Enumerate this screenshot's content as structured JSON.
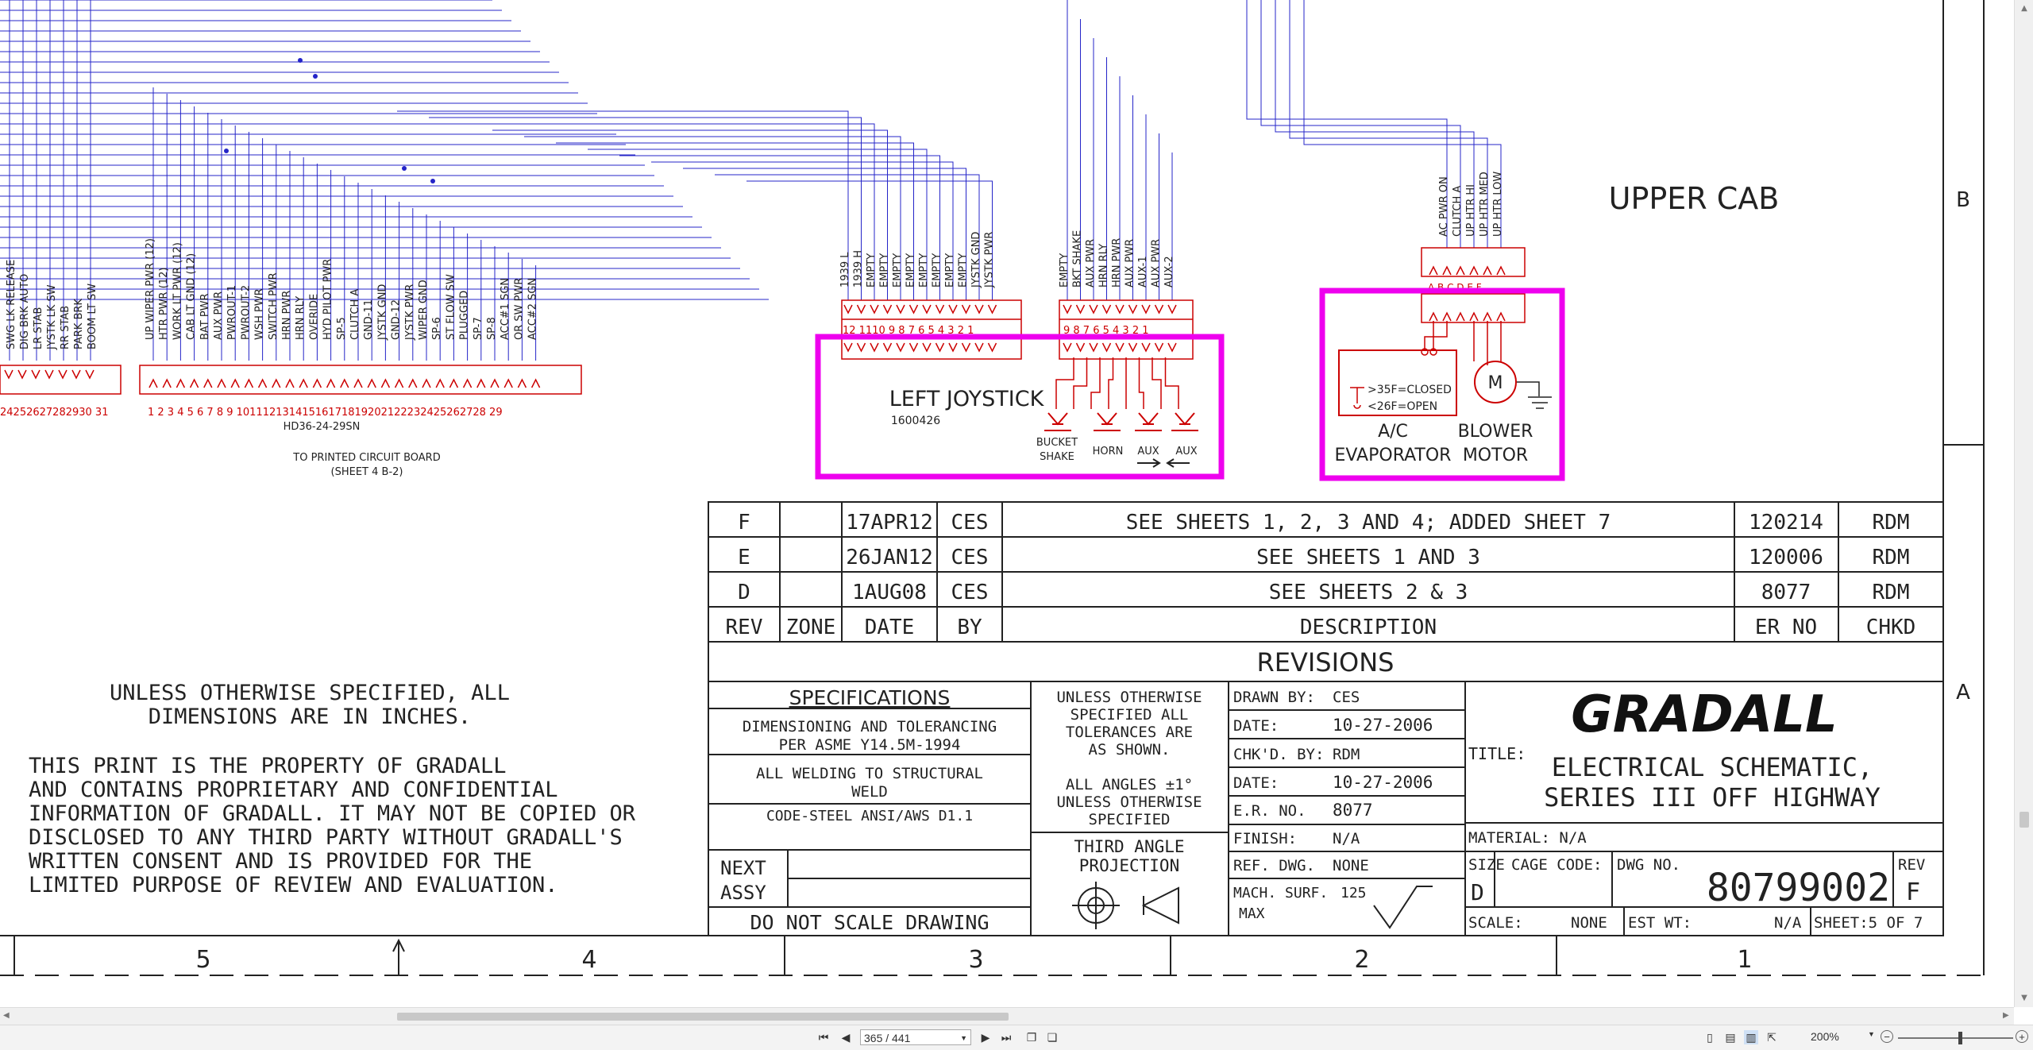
{
  "wires": {
    "left_block_labels": [
      "SWG LK RELEASE",
      "DIG BRK AUTO",
      "LR STAB",
      "JYSTK LK SW",
      "RR STAB",
      "PARK BRK",
      "BOOM LT SW"
    ],
    "left_block_pins": "24252627282930 31",
    "mid_block_labels": [
      "UP WIPER PWR (12)",
      "HTR PWR (12)",
      "WORK LT PWR (12)",
      "CAB LT GND (12)",
      "BAT PWR",
      "AUX PWR",
      "PWROUT-1",
      "PWROUT-2",
      "WSH PWR",
      "SWITCH PWR",
      "HRN PWR",
      "HRN RLY",
      "OVERIDE",
      "HYD PILOT PWR",
      "SP-5",
      "CLUTCH A",
      "GND-11",
      "JYSTK GND",
      "GND-12",
      "JYSTK PWR",
      "WIPER GND",
      "SP-6",
      "ST FLOW SW",
      "PLUGGED",
      "SP-7",
      "SP-8",
      "ACC#1 SGN",
      "OR SW PWR",
      "ACC#2 SGN"
    ],
    "mid_block_pins": "1 2 3 4 5 6 7 8 9 10111213141516171819202122232425262728 29",
    "connector_id": "HD36-24-29SN",
    "pcb_note_1": "TO PRINTED CIRCUIT BOARD",
    "pcb_note_2": "(SHEET 4 B-2)"
  },
  "left_joystick": {
    "labels": [
      "1939 L",
      "1939 H",
      "EMPTY",
      "EMPTY",
      "EMPTY",
      "EMPTY",
      "EMPTY",
      "EMPTY",
      "EMPTY",
      "EMPTY",
      "JYSTK GND",
      "JYSTK PWR"
    ],
    "pins": "12 1110 9 8 7 6 5 4 3 2 1",
    "title": "LEFT JOYSTICK",
    "part_no": "1600426"
  },
  "aux_connector": {
    "labels": [
      "EMPTY",
      "BKT SHAKE",
      "AUX PWR",
      "HRN RLY",
      "HRN PWR",
      "AUX PWR",
      "AUX-1",
      "AUX PWR",
      "AUX-2"
    ],
    "pins": "9 8 7 6 5 4 3 2 1",
    "bucket_shake_1": "BUCKET",
    "bucket_shake_2": "SHAKE",
    "horn": "HORN",
    "aux_a": "AUX",
    "aux_b": "AUX"
  },
  "upper_cab": {
    "title": "UPPER CAB",
    "hvac_labels": [
      "AC PWR ON",
      "CLUTCH A",
      "UP HTR HI",
      "UP HTR MED",
      "UP HTR LOW"
    ],
    "hvac_pins": "A B C D E F",
    "thermo_1": ">35F=CLOSED",
    "thermo_2": "<26F=OPEN",
    "motor_symbol": "M",
    "ac_1": "A/C",
    "ac_2": "EVAPORATOR",
    "blower_1": "BLOWER",
    "blower_2": "MOTOR"
  },
  "zones": {
    "b": "B",
    "a": "A",
    "cols": [
      "5",
      "4",
      "3",
      "2",
      "1"
    ]
  },
  "revisions": {
    "rows": [
      {
        "rev": "F",
        "zone": "",
        "date": "17APR12",
        "by": "CES",
        "desc": "SEE SHEETS 1, 2, 3 AND 4; ADDED SHEET 7",
        "er": "120214",
        "chkd": "RDM"
      },
      {
        "rev": "E",
        "zone": "",
        "date": "26JAN12",
        "by": "CES",
        "desc": "SEE SHEETS 1 AND 3",
        "er": "120006",
        "chkd": "RDM"
      },
      {
        "rev": "D",
        "zone": "",
        "date": "1AUG08",
        "by": "CES",
        "desc": "SEE SHEETS 2 & 3",
        "er": "8077",
        "chkd": "RDM"
      }
    ],
    "headers": {
      "rev": "REV",
      "zone": "ZONE",
      "date": "DATE",
      "by": "BY",
      "desc": "DESCRIPTION",
      "er": "ER NO",
      "chkd": "CHKD"
    },
    "title": "REVISIONS"
  },
  "notes": {
    "dims_1": "UNLESS OTHERWISE SPECIFIED, ALL",
    "dims_2": "DIMENSIONS ARE IN INCHES.",
    "prop": [
      "THIS PRINT IS THE PROPERTY OF GRADALL",
      "AND CONTAINS PROPRIETARY AND CONFIDENTIAL",
      "INFORMATION OF GRADALL. IT MAY NOT BE COPIED OR",
      "DISCLOSED TO ANY THIRD PARTY WITHOUT GRADALL'S",
      "WRITTEN CONSENT AND IS PROVIDED FOR THE",
      "LIMITED PURPOSE OF REVIEW AND EVALUATION."
    ]
  },
  "specs": {
    "title": "SPECIFICATIONS",
    "s1a": "DIMENSIONING AND TOLERANCING",
    "s1b": "PER ASME Y14.5M-1994",
    "s2a": "ALL WELDING TO STRUCTURAL",
    "s2b": "WELD",
    "s3": "CODE-STEEL ANSI/AWS D1.1",
    "next": "NEXT",
    "assy": "ASSY",
    "dns": "DO NOT SCALE DRAWING",
    "tol": [
      "UNLESS OTHERWISE",
      "SPECIFIED ALL",
      "TOLERANCES ARE",
      "AS SHOWN."
    ],
    "ang": [
      "ALL ANGLES ±1°",
      "UNLESS OTHERWISE",
      "SPECIFIED"
    ],
    "proj": [
      "THIRD ANGLE",
      "PROJECTION"
    ]
  },
  "title_block": {
    "drawn_by_label": "DRAWN BY:",
    "drawn_by": "CES",
    "date1_label": "DATE:",
    "date1": "10-27-2006",
    "chkd_label": "CHK'D. BY:",
    "chkd": "RDM",
    "date2_label": "DATE:",
    "date2": "10-27-2006",
    "er_label": "E.R. NO.",
    "er": "8077",
    "finish_label": "FINISH:",
    "finish": "N/A",
    "ref_label": "REF. DWG.",
    "ref": "NONE",
    "mach_1": "MACH. SURF.",
    "mach_val": "125",
    "mach_2": "MAX",
    "company": "GRADALL",
    "title_label": "TITLE:",
    "title_1": "ELECTRICAL SCHEMATIC,",
    "title_2": "SERIES III OFF HIGHWAY",
    "material": "MATERIAL: N/A",
    "size_label": "SIZE",
    "size": "D",
    "cage": "CAGE CODE:",
    "dwg_label": "DWG NO.",
    "dwg": "80799002",
    "rev_label": "REV",
    "rev": "F",
    "scale_label": "SCALE:",
    "scale": "NONE",
    "wt_label": "EST WT:",
    "wt": "N/A",
    "sheet": "SHEET:5 OF 7"
  },
  "viewer": {
    "page_value": "365 / 441",
    "zoom": "200%"
  }
}
